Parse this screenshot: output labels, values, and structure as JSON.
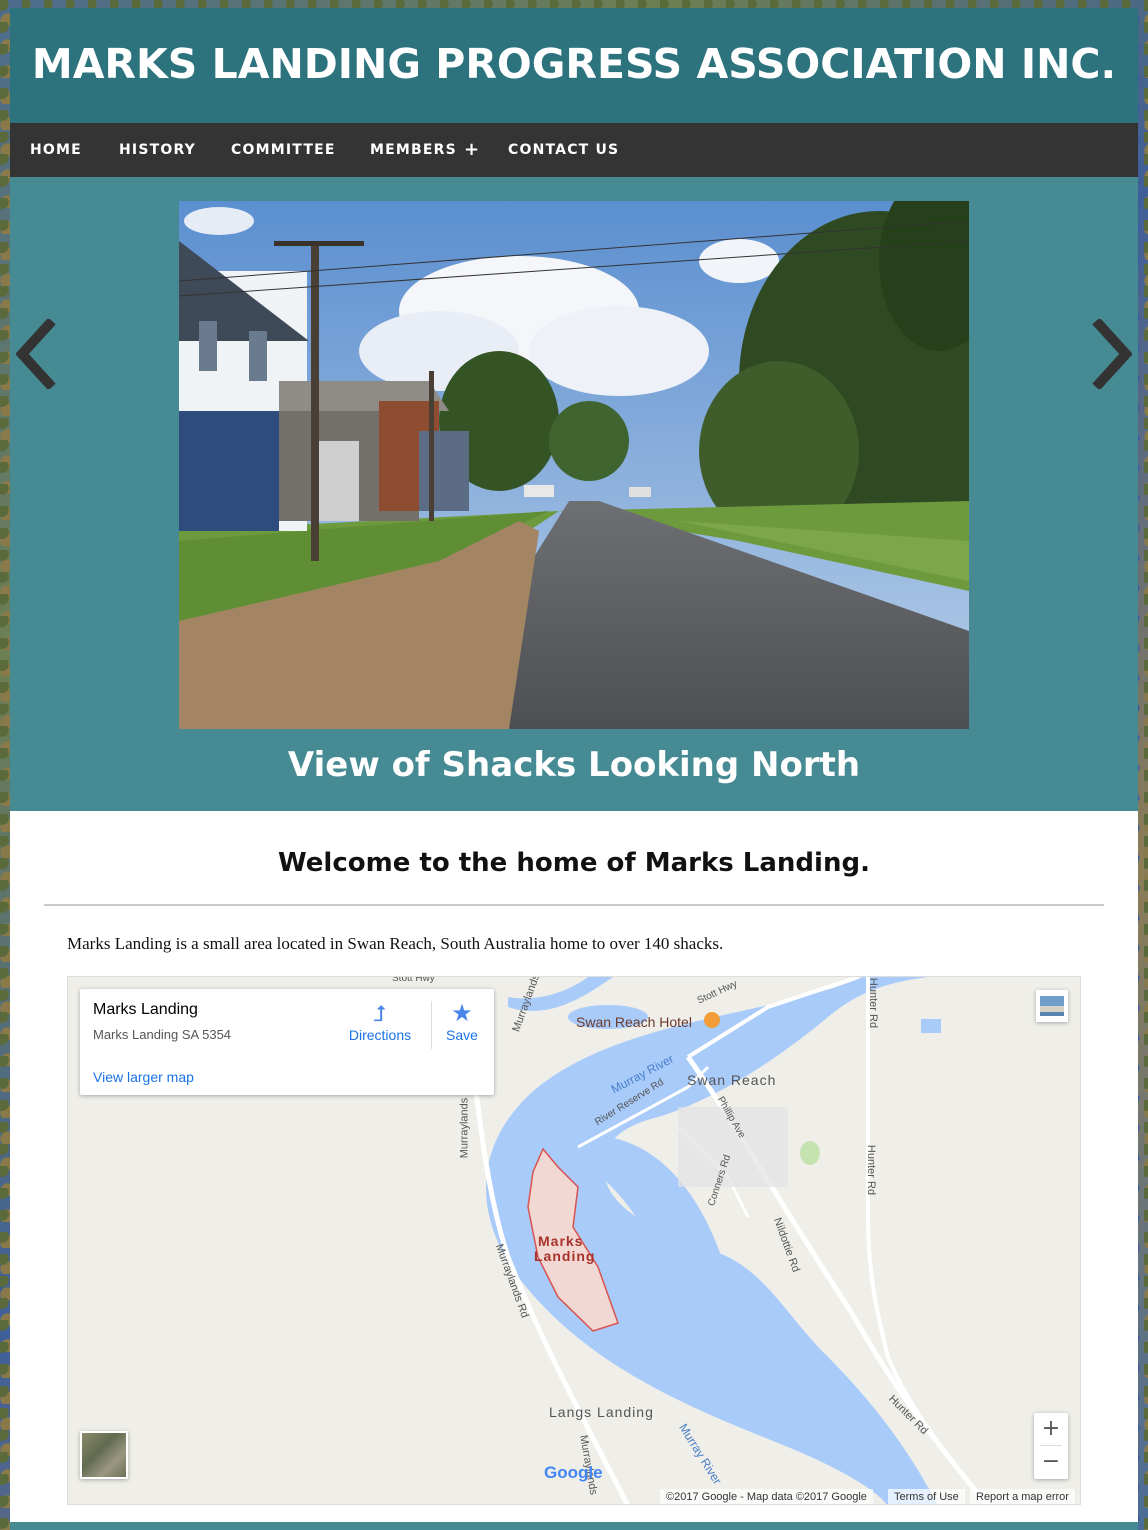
{
  "site": {
    "title": "MARKS LANDING PROGRESS ASSOCIATION INC."
  },
  "nav": {
    "items": [
      {
        "label": "HOME"
      },
      {
        "label": "HISTORY"
      },
      {
        "label": "COMMITTEE"
      },
      {
        "label": "MEMBERS"
      },
      {
        "label": "CONTACT US"
      }
    ],
    "members_expand": "+"
  },
  "slider": {
    "caption": "View of Shacks Looking North",
    "prev_icon": "chevron-left-icon",
    "next_icon": "chevron-right-icon"
  },
  "content": {
    "heading": "Welcome to the home of Marks Landing.",
    "intro": "Marks Landing is a small area located in Swan Reach, South Australia home to over 140 shacks."
  },
  "map": {
    "card": {
      "title": "Marks Landing",
      "address": "Marks Landing SA 5354",
      "directions": "Directions",
      "save": "Save",
      "larger": "View larger map"
    },
    "labels": {
      "hotel": "Swan Reach Hotel",
      "swan_reach": "Swan Reach",
      "marks_landing_1": "Marks",
      "marks_landing_2": "Landing",
      "langs_landing": "Langs Landing",
      "murray_river_1": "Murray River",
      "murray_river_2": "Murray River",
      "river_reserve": "River Reserve Rd",
      "phillip": "Phillip Ave",
      "conners": "Conners Rd",
      "nildottie": "Nildottie Rd",
      "hunter_1": "Hunter Rd",
      "hunter_2": "Hunter Rd",
      "hunter_3": "Hunter Rd",
      "murraylands_1": "Murraylands Rd",
      "murraylands_2": "Murraylands",
      "murraylands_3": "Murraylands",
      "murraylands_4": "Murraylands",
      "stott_1": "Stott Hwy",
      "stott_2": "Stott Hwy"
    },
    "zoom_in": "+",
    "zoom_out": "−",
    "google": "Google",
    "attribution": "©2017 Google - Map data ©2017 Google",
    "terms": "Terms of Use",
    "report": "Report a map error"
  },
  "colors": {
    "header": "#2c737e",
    "nav": "#343434",
    "slider": "#468a94",
    "water": "#a8cbfa",
    "link": "#1a73e8"
  }
}
